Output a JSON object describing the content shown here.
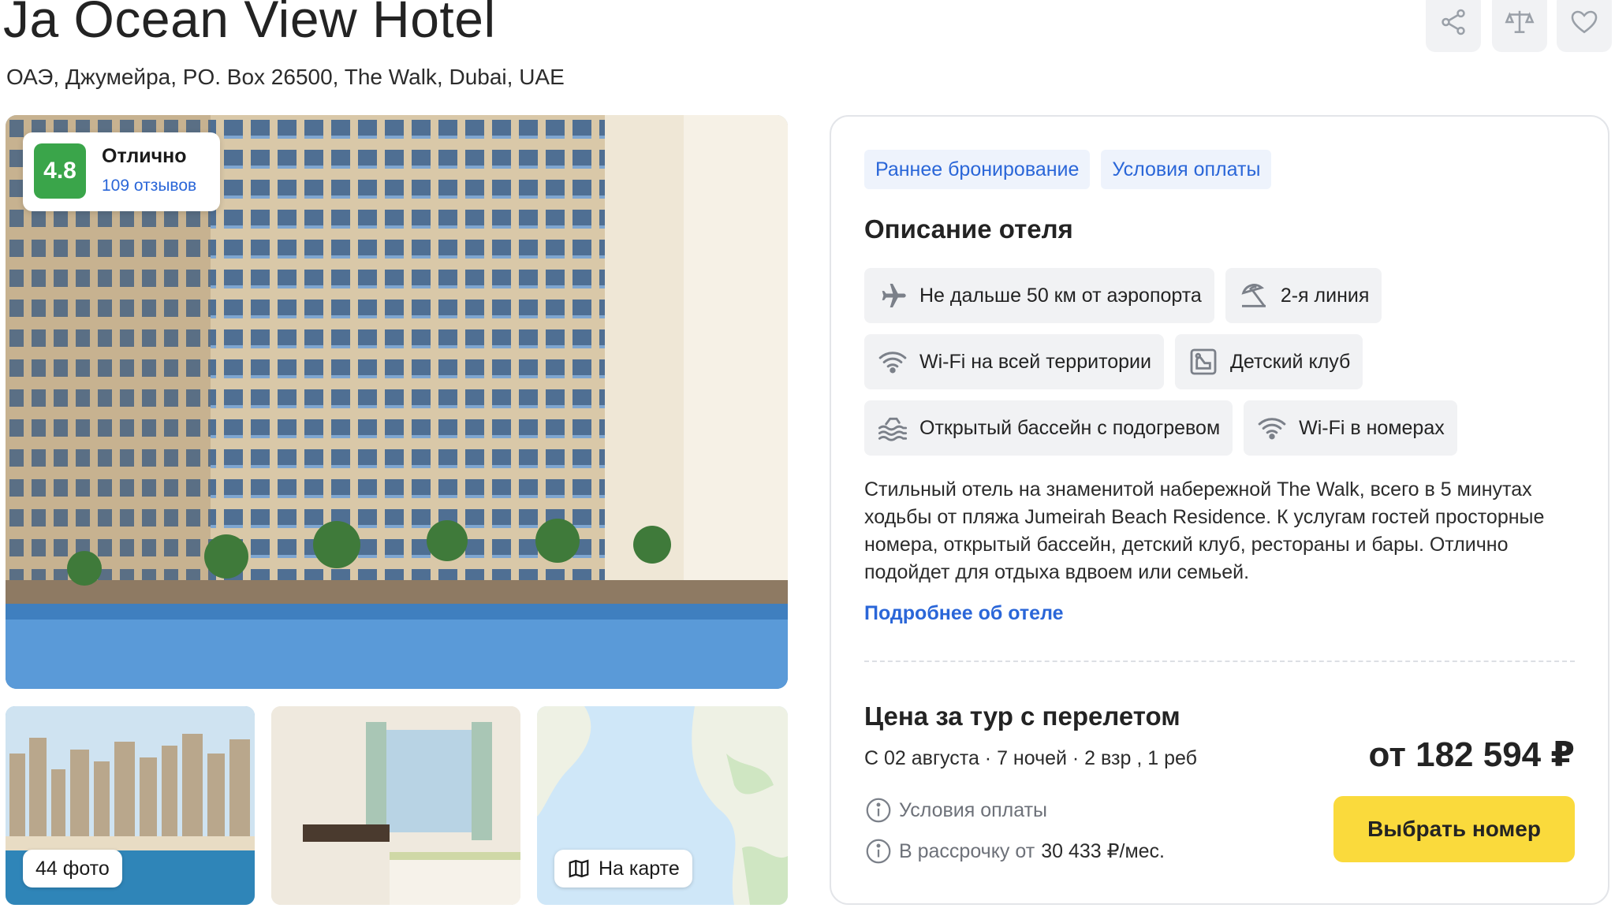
{
  "hotel": {
    "name": "Ja Ocean View Hotel",
    "address": "ОАЭ, Джумейра, PO. Box 26500, The Walk, Dubai, UAE"
  },
  "actions": {
    "share_icon": "share-icon",
    "compare_icon": "scales-icon",
    "favorite_icon": "heart-icon"
  },
  "rating": {
    "score": "4.8",
    "label": "Отлично",
    "reviews": "109 отзывов",
    "color": "#3aa54a"
  },
  "gallery": {
    "photos_label": "44 фото",
    "map_label": "На карте"
  },
  "tags": [
    "Раннее бронирование",
    "Условия оплаты"
  ],
  "description": {
    "title": "Описание отеля",
    "amenities": [
      {
        "icon": "airplane-icon",
        "label": "Не дальше 50 км от аэропорта"
      },
      {
        "icon": "beach-umbrella-icon",
        "label": "2-я линия"
      },
      {
        "icon": "wifi-icon",
        "label": "Wi-Fi на всей территории"
      },
      {
        "icon": "kids-club-icon",
        "label": "Детский клуб"
      },
      {
        "icon": "pool-icon",
        "label": "Открытый бассейн с подогревом"
      },
      {
        "icon": "wifi-icon",
        "label": "Wi-Fi в номерах"
      }
    ],
    "text": "Стильный отель на знаменитой набережной The Walk, всего в 5 минутах ходьбы от пляжа Jumeirah Beach Residence. К услугам гостей просторные номера, открытый бассейн, детский клуб, рестораны и бары. Отлично подойдет для отдыха вдвоем или семьей.",
    "more_link": "Подробнее об отеле"
  },
  "pricing": {
    "title": "Цена за тур с перелетом",
    "trip_info": "С 02 августа · 7 ночей · 2 взр , 1 реб",
    "price": "от 182 594 ₽",
    "payment_terms": "Условия оплаты",
    "installment_prefix": "В рассрочку от",
    "installment_value": "30 433 ₽/мес.",
    "button_label": "Выбрать номер",
    "button_color": "#fada3c"
  },
  "colors": {
    "link": "#2a66d8",
    "tag_bg": "#eef3fc",
    "chip_bg": "#f1f2f4"
  }
}
